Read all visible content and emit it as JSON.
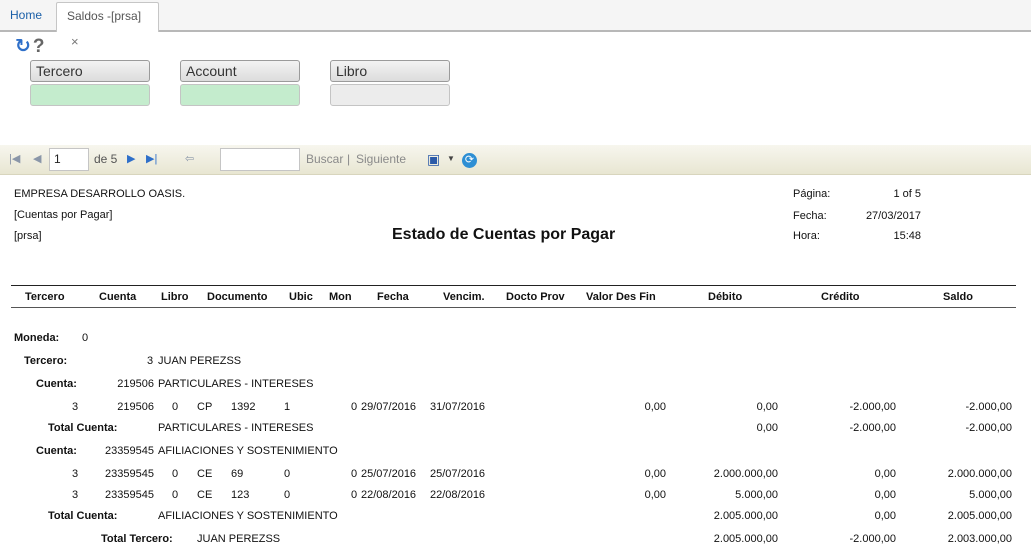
{
  "tabs": {
    "home": "Home",
    "active": "Saldos -[prsa]",
    "close": "×"
  },
  "icons": {
    "refresh": "refresh-icon",
    "help": "help-icon",
    "accent": "#2e6fc9"
  },
  "filters": [
    {
      "label": "Tercero",
      "value": "",
      "color": "#c4eccd"
    },
    {
      "label": "Account",
      "value": "",
      "color": "#c4eccd"
    },
    {
      "label": "Libro",
      "value": "",
      "color": "#ececec"
    }
  ],
  "toolbar": {
    "page": "1",
    "of_pages": "de 5",
    "search_placeholder": "",
    "find": "Buscar",
    "sep": "|",
    "next": "Siguiente"
  },
  "report": {
    "company": "EMPRESA DESARROLLO OASIS.",
    "subtitle": "[Cuentas por Pagar]",
    "user": "[prsa]",
    "title": "Estado de Cuentas por Pagar",
    "meta": {
      "page_label": "Página:",
      "page_value": "1 of 5",
      "date_label": "Fecha:",
      "date_value": "27/03/2017",
      "time_label": "Hora:",
      "time_value": "15:48"
    },
    "columns": [
      "Tercero",
      "Cuenta",
      "Libro",
      "Documento",
      "Ubic",
      "Mon",
      "Fecha",
      "Vencim.",
      "Docto Prov",
      "Valor Des Fin",
      "Débito",
      "Crédito",
      "Saldo"
    ],
    "currency_label": "Moneda:",
    "currency_value": "0",
    "tercero_label": "Tercero:",
    "tercero_id": "3",
    "tercero_name": "JUAN PEREZSS",
    "cuenta_label": "Cuenta:",
    "total_cuenta_label": "Total Cuenta:",
    "total_tercero_label": "Total Tercero:",
    "groups": [
      {
        "account": "219506",
        "account_name": "PARTICULARES - INTERESES",
        "rows": [
          {
            "tercero": "3",
            "cuenta": "219506",
            "libro": "0",
            "doc_type": "CP",
            "doc_num": "1392",
            "ubic": "1",
            "mon": "0",
            "fecha": "29/07/2016",
            "vencim": "31/07/2016",
            "valor": "0,00",
            "debito": "0,00",
            "credito": "-2.000,00",
            "saldo": "-2.000,00"
          }
        ],
        "total": {
          "name": "PARTICULARES - INTERESES",
          "debito": "0,00",
          "credito": "-2.000,00",
          "saldo": "-2.000,00"
        }
      },
      {
        "account": "23359545",
        "account_name": "AFILIACIONES Y SOSTENIMIENTO",
        "rows": [
          {
            "tercero": "3",
            "cuenta": "23359545",
            "libro": "0",
            "doc_type": "CE",
            "doc_num": "69",
            "ubic": "0",
            "mon": "0",
            "fecha": "25/07/2016",
            "vencim": "25/07/2016",
            "valor": "0,00",
            "debito": "2.000.000,00",
            "credito": "0,00",
            "saldo": "2.000.000,00"
          },
          {
            "tercero": "3",
            "cuenta": "23359545",
            "libro": "0",
            "doc_type": "CE",
            "doc_num": "123",
            "ubic": "0",
            "mon": "0",
            "fecha": "22/08/2016",
            "vencim": "22/08/2016",
            "valor": "0,00",
            "debito": "5.000,00",
            "credito": "0,00",
            "saldo": "5.000,00"
          }
        ],
        "total": {
          "name": "AFILIACIONES Y SOSTENIMIENTO",
          "debito": "2.005.000,00",
          "credito": "0,00",
          "saldo": "2.005.000,00"
        }
      }
    ],
    "tercero_total": {
      "name": "JUAN PEREZSS",
      "debito": "2.005.000,00",
      "credito": "-2.000,00",
      "saldo": "2.003.000,00"
    }
  }
}
